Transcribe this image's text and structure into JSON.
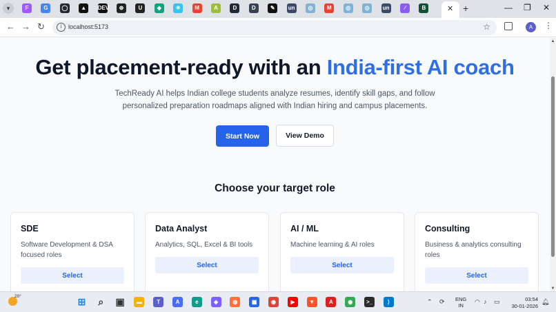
{
  "browser": {
    "url": "localhost:5173",
    "tab_favicons": [
      {
        "name": "figma-tab",
        "glyph": "F",
        "color": "#a259ff"
      },
      {
        "name": "google-tab",
        "glyph": "G",
        "color": "#4285f4"
      },
      {
        "name": "github-tab",
        "glyph": "◯",
        "color": "#24292f"
      },
      {
        "name": "vercel-tab",
        "glyph": "▲",
        "color": "#111111"
      },
      {
        "name": "dev-tab",
        "glyph": "DEV",
        "color": "#111111"
      },
      {
        "name": "openai-tab",
        "glyph": "⊛",
        "color": "#222222"
      },
      {
        "name": "notion-tab",
        "glyph": "U",
        "color": "#222222"
      },
      {
        "name": "gem-tab",
        "glyph": "◆",
        "color": "#10a37f"
      },
      {
        "name": "slack-tab",
        "glyph": "✳",
        "color": "#36c5f0"
      },
      {
        "name": "gmail-tab",
        "glyph": "M",
        "color": "#ea4335"
      },
      {
        "name": "poster-tab",
        "glyph": "A",
        "color": "#9bbf3b"
      },
      {
        "name": "d-tab",
        "glyph": "D",
        "color": "#1f2937"
      },
      {
        "name": "d2-tab",
        "glyph": "D",
        "color": "#374151"
      },
      {
        "name": "pen-tab",
        "glyph": "✎",
        "color": "#111111"
      },
      {
        "name": "un-tab",
        "glyph": "un",
        "color": "#3b4a6b"
      },
      {
        "name": "web-tab",
        "glyph": "◎",
        "color": "#7fb3d5"
      },
      {
        "name": "gmail2-tab",
        "glyph": "M",
        "color": "#ea4335"
      },
      {
        "name": "web2-tab",
        "glyph": "◎",
        "color": "#7fb3d5"
      },
      {
        "name": "web3-tab",
        "glyph": "◎",
        "color": "#7fb3d5"
      },
      {
        "name": "un2-tab",
        "glyph": "un",
        "color": "#3b4a6b"
      },
      {
        "name": "ai-tab",
        "glyph": "∕",
        "color": "#8b5cf6"
      },
      {
        "name": "b-tab",
        "glyph": "B",
        "color": "#0f5132"
      }
    ],
    "active_tab_close": "✕",
    "new_tab": "+",
    "window_controls": [
      "—",
      "❐",
      "✕"
    ],
    "profile_initial": "A"
  },
  "hero": {
    "title_main": "Get placement-ready with an",
    "title_accent": "India-first AI coach",
    "subtitle": "TechReady AI helps Indian college students analyze resumes, identify skill gaps, and follow personalized preparation roadmaps aligned with Indian hiring and campus placements.",
    "primary_cta": "Start Now",
    "secondary_cta": "View Demo"
  },
  "roles": {
    "heading": "Choose your target role",
    "cards": [
      {
        "title": "SDE",
        "description": "Software Development & DSA focused roles",
        "button": "Select"
      },
      {
        "title": "Data Analyst",
        "description": "Analytics, SQL, Excel & BI tools",
        "button": "Select"
      },
      {
        "title": "AI / ML",
        "description": "Machine learning & AI roles",
        "button": "Select"
      },
      {
        "title": "Consulting",
        "description": "Business & analytics consulting roles",
        "button": "Select"
      }
    ]
  },
  "taskbar": {
    "temperature": "20°",
    "language_line1": "ENG",
    "language_line2": "IN",
    "time": "03:54",
    "date": "30-01-2026",
    "apps": [
      {
        "name": "start-icon",
        "glyph": "⊞",
        "color": "#1e88e5"
      },
      {
        "name": "search-icon",
        "glyph": "⌕",
        "color": "#333333"
      },
      {
        "name": "task-view-icon",
        "glyph": "▣",
        "color": "#333333"
      },
      {
        "name": "file-explorer-icon",
        "glyph": "▬",
        "color": "#f2b400"
      },
      {
        "name": "teams-icon",
        "glyph": "T",
        "color": "#5b5fc7"
      },
      {
        "name": "arc-icon",
        "glyph": "A",
        "color": "#4a6cf7"
      },
      {
        "name": "edge-icon",
        "glyph": "e",
        "color": "#0f9d8a"
      },
      {
        "name": "copilot-icon",
        "glyph": "◆",
        "color": "#7b61ff"
      },
      {
        "name": "firefox-icon",
        "glyph": "◍",
        "color": "#ff7139"
      },
      {
        "name": "store-icon",
        "glyph": "▦",
        "color": "#2563eb"
      },
      {
        "name": "chrome-icon",
        "glyph": "◉",
        "color": "#db4437"
      },
      {
        "name": "youtube-icon",
        "glyph": "▶",
        "color": "#ff0000"
      },
      {
        "name": "brave-icon",
        "glyph": "▼",
        "color": "#fb542b"
      },
      {
        "name": "acrobat-icon",
        "glyph": "A",
        "color": "#d7201f"
      },
      {
        "name": "chrome-active-icon",
        "glyph": "◉",
        "color": "#34a853"
      },
      {
        "name": "terminal-icon",
        "glyph": ">_",
        "color": "#2b2b2b"
      },
      {
        "name": "vscode-icon",
        "glyph": "⟩",
        "color": "#007acc"
      }
    ]
  }
}
